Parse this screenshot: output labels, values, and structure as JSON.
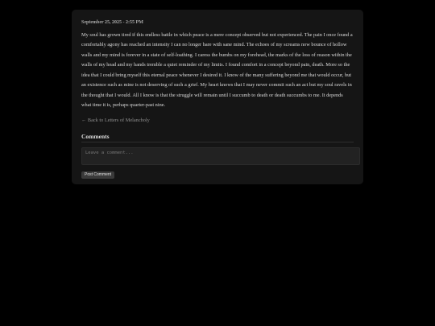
{
  "entry": {
    "date": "September 25, 2025 - 2:55 PM",
    "body": "My soul has grown tired if this endless battle in which peace is a mere concept observed but not experienced. The pain I once found a comfortably agony has reached an intensity I can no longer bare with sane mind. The echoes of my screams now bounce of hollow walls and my mind is forever in a state of self-loathing. I caress the bumbs on my forehead, the marks of the loss of reason within the walls of my head and my hands tremble a quiet reminder of my limits. I found comfort in a concept beyond pain, death. More so the idea that I could bring myself this eternal peace whenever I desired it. I know of the many suffering beyond me that would occur, but an existence such as mine is not deserving of such a grief. My heart knows that I may never commit such an act but my soul ravels in the thought that I would. All I know is that the struggle will remain until I succumb to death or death succumbs to me. It depends what time it is, perhaps quarter-past nine."
  },
  "nav": {
    "back_label": "← Back to Letters of Melancholy"
  },
  "comments": {
    "heading": "Comments",
    "placeholder": "Leave a comment...",
    "value": "",
    "post_label": "Post Comment"
  }
}
